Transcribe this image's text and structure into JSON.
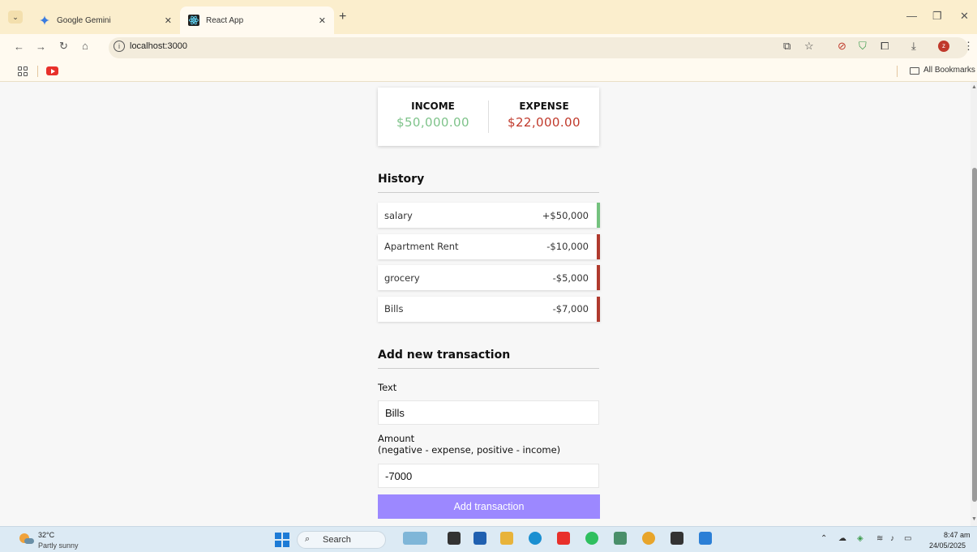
{
  "browser": {
    "tabs": [
      {
        "title": "Google Gemini",
        "active": false
      },
      {
        "title": "React App",
        "active": true
      }
    ],
    "url": "localhost:3000",
    "bookmarks_label": "All Bookmarks"
  },
  "app": {
    "income_label": "Income",
    "income_value": "$50,000.00",
    "expense_label": "Expense",
    "expense_value": "$22,000.00",
    "history_title": "History",
    "transactions": [
      {
        "text": "salary",
        "amount": "+$50,000",
        "type": "plus"
      },
      {
        "text": "Apartment Rent",
        "amount": "-$10,000",
        "type": "minus"
      },
      {
        "text": "grocery",
        "amount": "-$5,000",
        "type": "minus"
      },
      {
        "text": "Bills",
        "amount": "-$7,000",
        "type": "minus"
      }
    ],
    "form": {
      "title": "Add new transaction",
      "text_label": "Text",
      "text_value": "Bills",
      "amount_label": "Amount",
      "amount_hint": "(negative - expense, positive - income)",
      "amount_value": "-7000",
      "submit_label": "Add transaction"
    },
    "colors": {
      "income": "#7ec38a",
      "expense": "#c0392b",
      "button": "#9c88ff"
    }
  },
  "taskbar": {
    "temperature": "32°C",
    "weather": "Partly sunny",
    "search_label": "Search",
    "time": "8:47 am",
    "date": "24/05/2025"
  }
}
